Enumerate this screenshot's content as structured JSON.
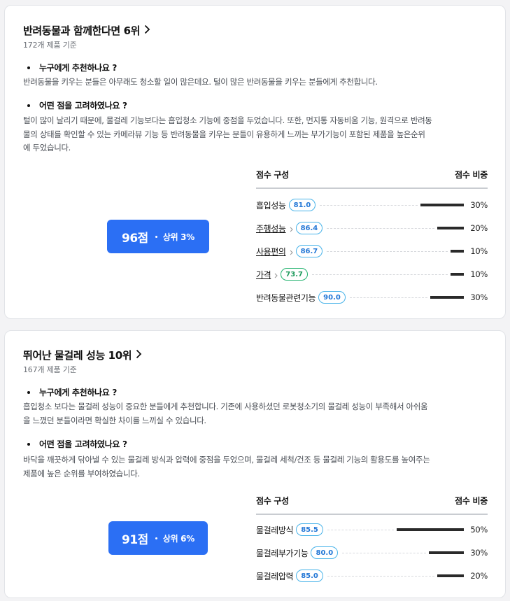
{
  "cards": [
    {
      "title": "반려동물과 함께한다면 6위",
      "subtitle": "172개 제품 기준",
      "q1": "누구에게 추천하나요 ?",
      "a1": "반려동물을 키우는 분들은 아무래도 청소할 일이 많은데요. 털이 많은 반려동물을 키우는 분들에게 추천합니다.",
      "q2": "어떤 점을 고려하였나요 ?",
      "a2_lines": [
        "털이 많이 날리기 때문에, 물걸레 기능보다는 흡입청소 기능에 중점을 두었습니다. 또한, 먼지통 자동비움 기능, 원격으로 반려동",
        "물의 상태를 확인할 수 있는 카메라뷰 기능 등 반려동물을 키우는 분들이 유용하게 느끼는 부가기능이 포함된 제품을 높은순위",
        "에 두었습니다."
      ],
      "score": "96점",
      "rank": "상위 3%",
      "table_head_left": "점수 구성",
      "table_head_right": "점수 비중",
      "rows": [
        {
          "name": "흡입성능",
          "value": "81.0",
          "weight": "30%",
          "weight_frac": 0.3,
          "link": false,
          "pill": "blue"
        },
        {
          "name": "주행성능",
          "value": "86.4",
          "weight": "20%",
          "weight_frac": 0.2,
          "link": true,
          "pill": "blue"
        },
        {
          "name": "사용편의",
          "value": "86.7",
          "weight": "10%",
          "weight_frac": 0.1,
          "link": true,
          "pill": "blue"
        },
        {
          "name": "가격",
          "value": "73.7",
          "weight": "10%",
          "weight_frac": 0.1,
          "link": true,
          "pill": "green"
        },
        {
          "name": "반려동물관련기능",
          "value": "90.0",
          "weight": "30%",
          "weight_frac": 0.3,
          "link": false,
          "pill": "blue"
        }
      ]
    },
    {
      "title": "뛰어난 물걸레 성능 10위",
      "subtitle": "167개 제품 기준",
      "q1": "누구에게 추천하나요 ?",
      "a1_lines": [
        "흡입청소 보다는 물걸레 성능이 중요한 분들에게 추천합니다. 기존에 사용하셨던 로봇청소기의 물걸레 성능이 부족해서 아쉬움",
        "을 느꼈던 분들이라면 확실한 차이를 느끼실 수 있습니다."
      ],
      "q2": "어떤 점을 고려하였나요 ?",
      "a2_lines": [
        "바닥을 깨끗하게 닦아낼 수 있는 물걸레 방식과 압력에 중점을 두었으며, 물걸레 세척/건조 등 물걸레 기능의 활용도를 높여주는",
        "제품에 높은 순위를 부여하였습니다."
      ],
      "score": "91점",
      "rank": "상위 6%",
      "table_head_left": "점수 구성",
      "table_head_right": "점수 비중",
      "rows": [
        {
          "name": "물걸레방식",
          "value": "85.5",
          "weight": "50%",
          "weight_frac": 0.5,
          "link": false,
          "pill": "blue"
        },
        {
          "name": "물걸레부가기능",
          "value": "80.0",
          "weight": "30%",
          "weight_frac": 0.3,
          "link": false,
          "pill": "blue"
        },
        {
          "name": "물걸레압력",
          "value": "85.0",
          "weight": "20%",
          "weight_frac": 0.2,
          "link": false,
          "pill": "blue"
        }
      ]
    }
  ],
  "colors": {
    "accent": "#2b6ff4",
    "pill_blue": "#48b3e9",
    "pill_green": "#23b36f",
    "bar": "#2a2a2a"
  }
}
